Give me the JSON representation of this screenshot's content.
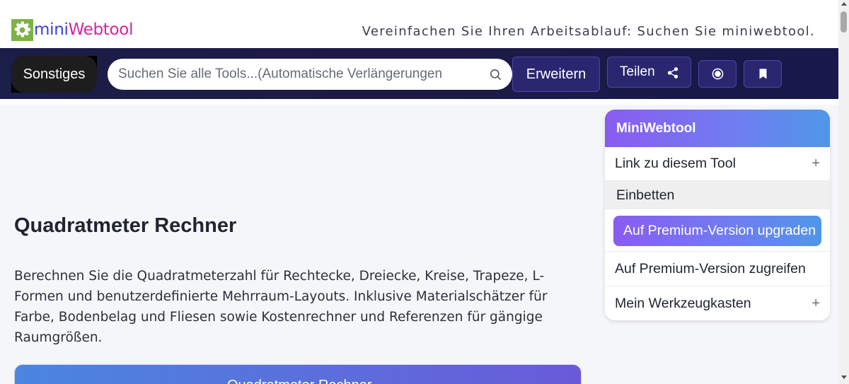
{
  "header": {
    "logo_mini": "mini",
    "logo_web": "Webtool",
    "tagline": "Vereinfachen Sie Ihren Arbeitsablauf: Suchen Sie miniwebtool."
  },
  "nav": {
    "category_label": "Sonstiges",
    "search_placeholder": "Suchen Sie alle Tools...(Automatische Verlängerungen",
    "expand_label": "Erweitern",
    "share_label": "Teilen"
  },
  "main": {
    "title": "Quadratmeter Rechner",
    "description": "Berechnen Sie die Quadratmeterzahl für Rechtecke, Dreiecke, Kreise, Trapeze, L-Formen und benutzerdefinierte Mehrraum-Layouts. Inklusive Materialschätzer für Farbe, Bodenbelag und Fliesen sowie Kostenrechner und Referenzen für gängige Raumgrößen.",
    "calculator_label": "Quadratmeter Rechner"
  },
  "widget": {
    "title": "MiniWebtool",
    "link_label": "Link zu diesem Tool",
    "embed_label": "Einbetten",
    "upgrade_label": "Auf Premium-Version upgraden",
    "access_label": "Auf Premium-Version zugreifen",
    "toolbox_label": "Mein Werkzeugkasten",
    "plus_symbol": "+"
  },
  "colors": {
    "brand_green": "#7cb342",
    "brand_blue": "#3b3fd8",
    "brand_pink": "#d6249f",
    "nav_bg": "#1a1e48",
    "accent_purple": "#8a5cf0",
    "accent_blue": "#4f97e8"
  },
  "icons": {
    "logo": "gear-icon",
    "search": "search-icon",
    "share": "share-icon",
    "record": "record-icon",
    "bookmark": "bookmark-icon"
  }
}
